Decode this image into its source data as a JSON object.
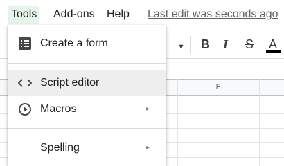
{
  "menubar": {
    "tools": "Tools",
    "addons": "Add-ons",
    "help": "Help",
    "last_edit": "Last edit was seconds ago"
  },
  "toolbar": {
    "dropdown_icon": "chevron-down-icon",
    "bold": "B",
    "italic": "I",
    "strikethrough": "S",
    "text_color": "A",
    "text_color_value": "#000000"
  },
  "grid": {
    "column_f": "F"
  },
  "tools_menu": {
    "items": [
      {
        "label": "Create a form",
        "icon": "form-icon",
        "has_submenu": false
      },
      {
        "label": "Script editor",
        "icon": "code-icon",
        "has_submenu": false,
        "highlighted": true
      },
      {
        "label": "Macros",
        "icon": "play-circle-icon",
        "has_submenu": true
      },
      {
        "label": "Spelling",
        "icon": "",
        "has_submenu": true
      }
    ],
    "submenu_arrow": "▸"
  },
  "colors": {
    "active_menu_bg": "#e6f4ea",
    "hover_item_bg": "#eeeeee"
  }
}
